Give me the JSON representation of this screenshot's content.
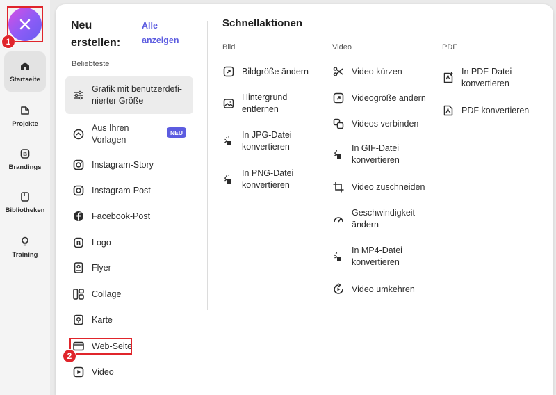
{
  "rail": {
    "close_label": "close",
    "badge_one": "1",
    "items": [
      {
        "label": "Startseite",
        "icon": "home-icon",
        "active": true
      },
      {
        "label": "Projekte",
        "icon": "projects-icon"
      },
      {
        "label": "Brandings",
        "icon": "brand-icon"
      },
      {
        "label": "Bibliotheken",
        "icon": "library-icon"
      },
      {
        "label": "Training",
        "icon": "lightbulb-icon"
      }
    ]
  },
  "create": {
    "title": "Neu erstellen:",
    "see_all": "Alle anzeigen",
    "popular_label": "Beliebteste",
    "new_badge": "NEU",
    "items": [
      {
        "label": "Grafik mit benutzerdefi-nierter Größe",
        "icon": "sliders-icon"
      },
      {
        "label": "Aus Ihren Vorlagen",
        "icon": "templates-icon"
      },
      {
        "label": "Instagram-Story",
        "icon": "instagram-icon"
      },
      {
        "label": "Instagram-Post",
        "icon": "instagram-icon"
      },
      {
        "label": "Facebook-Post",
        "icon": "facebook-icon"
      },
      {
        "label": "Logo",
        "icon": "brand-icon"
      },
      {
        "label": "Flyer",
        "icon": "flyer-icon"
      },
      {
        "label": "Collage",
        "icon": "collage-icon"
      },
      {
        "label": "Karte",
        "icon": "card-icon"
      },
      {
        "label": "Web-Seite",
        "icon": "webpage-icon"
      },
      {
        "label": "Video",
        "icon": "video-icon"
      }
    ],
    "badge_two": "2"
  },
  "quick": {
    "title": "Schnellaktionen",
    "image_label": "Bild",
    "video_label": "Video",
    "pdf_label": "PDF",
    "image_items": [
      "Bildgröße ändern",
      "Hintergrund entfernen",
      "In JPG-Datei konvertieren",
      "In PNG-Datei konvertieren"
    ],
    "video_items": [
      "Video kürzen",
      "Videogröße ändern",
      "Videos verbinden",
      "In GIF-Datei konvertieren",
      "Video zuschneiden",
      "Geschwindigkeit ändern",
      "In MP4-Datei konvertieren",
      "Video umkehren"
    ],
    "pdf_items": [
      "In PDF-Datei konvertieren",
      "PDF konvertieren"
    ]
  },
  "colors": {
    "accent": "#5c5ce0",
    "highlight": "#e0252b"
  }
}
